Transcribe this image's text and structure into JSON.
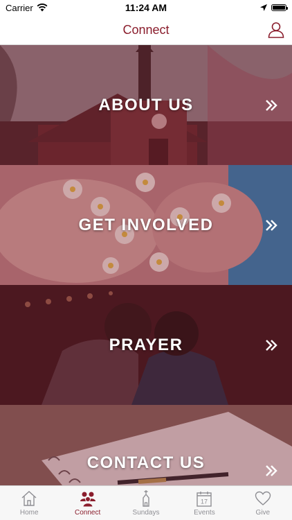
{
  "status_bar": {
    "carrier": "Carrier",
    "time": "11:24 AM"
  },
  "nav": {
    "title": "Connect",
    "profile_icon": "person-outline-icon"
  },
  "tiles": [
    {
      "label": "ABOUT US"
    },
    {
      "label": "GET INVOLVED"
    },
    {
      "label": "PRAYER"
    },
    {
      "label": "CONTACT US"
    }
  ],
  "tab_bar": {
    "items": [
      {
        "label": "Home",
        "icon": "home-icon"
      },
      {
        "label": "Connect",
        "icon": "people-icon"
      },
      {
        "label": "Sundays",
        "icon": "church-icon"
      },
      {
        "label": "Events",
        "icon": "calendar-icon",
        "calendar_day": "17"
      },
      {
        "label": "Give",
        "icon": "heart-icon"
      }
    ],
    "active": "Connect"
  },
  "colors": {
    "accent": "#8a1d2c",
    "inactive": "#8e8e93"
  }
}
